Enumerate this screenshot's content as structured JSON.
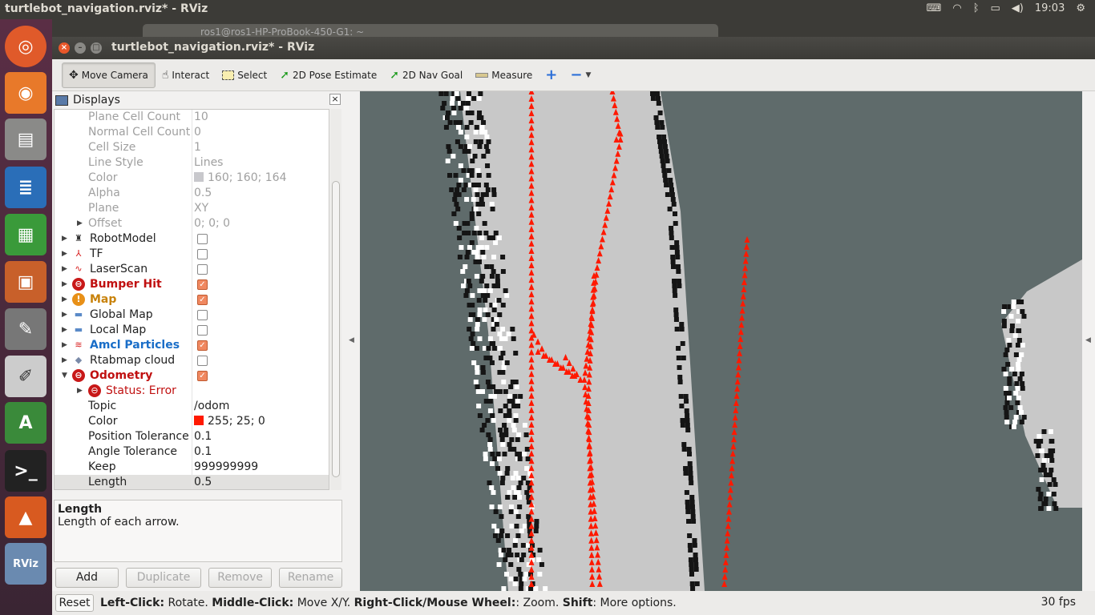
{
  "topbar": {
    "title": "turtlebot_navigation.rviz* - RViz",
    "clock": "19:03",
    "keyboard_icon": "keyboard-icon",
    "wifi_icon": "wifi-icon",
    "bluetooth_icon": "bluetooth-icon",
    "battery_icon": "battery-icon",
    "volume_icon": "volume-icon"
  },
  "background_window": {
    "title": "ros1@ros1-HP-ProBook-450-G1: ~"
  },
  "window": {
    "title": "turtlebot_navigation.rviz* - RViz"
  },
  "toolbar": {
    "move_camera": "Move Camera",
    "interact": "Interact",
    "select": "Select",
    "pose_estimate": "2D Pose Estimate",
    "nav_goal": "2D Nav Goal",
    "measure": "Measure",
    "plus": "+",
    "minus": "−"
  },
  "displays": {
    "title": "Displays",
    "rows": [
      {
        "name": "Plane Cell Count",
        "value": "10"
      },
      {
        "name": "Normal Cell Count",
        "value": "0"
      },
      {
        "name": "Cell Size",
        "value": "1"
      },
      {
        "name": "Line Style",
        "value": "Lines"
      },
      {
        "name": "Color",
        "value": "160; 160; 164"
      },
      {
        "name": "Alpha",
        "value": "0.5"
      },
      {
        "name": "Plane",
        "value": "XY"
      },
      {
        "name": "Offset",
        "value": "0; 0; 0"
      },
      {
        "name": "RobotModel",
        "checked": false
      },
      {
        "name": "TF",
        "checked": false
      },
      {
        "name": "LaserScan",
        "checked": false
      },
      {
        "name": "Bumper Hit",
        "checked": true
      },
      {
        "name": "Map",
        "checked": true
      },
      {
        "name": "Global Map",
        "checked": false
      },
      {
        "name": "Local Map",
        "checked": false
      },
      {
        "name": "Amcl Particles",
        "checked": true
      },
      {
        "name": "Rtabmap cloud",
        "checked": false
      },
      {
        "name": "Odometry",
        "checked": true
      },
      {
        "name": "Status: Error",
        "value": ""
      },
      {
        "name": "Topic",
        "value": "/odom"
      },
      {
        "name": "Color",
        "value": "255; 25; 0"
      },
      {
        "name": "Position Tolerance",
        "value": "0.1"
      },
      {
        "name": "Angle Tolerance",
        "value": "0.1"
      },
      {
        "name": "Keep",
        "value": "999999999"
      },
      {
        "name": "Length",
        "value": "0.5"
      }
    ]
  },
  "description": {
    "title": "Length",
    "text": "Length of each arrow."
  },
  "buttons": {
    "add": "Add",
    "duplicate": "Duplicate",
    "remove": "Remove",
    "rename": "Rename"
  },
  "status": {
    "reset": "Reset",
    "lc": "Left-Click:",
    "lc_t": " Rotate. ",
    "mc": "Middle-Click:",
    "mc_t": " Move X/Y. ",
    "rc": "Right-Click/Mouse Wheel:",
    "rc_t": ": Zoom. ",
    "sh": "Shift",
    "sh_t": ": More options.",
    "fps": "30 fps"
  },
  "colors": {
    "odom_arrow": "#ff1900",
    "map_free": "#c8c8c8",
    "map_unknown": "#5f6b6b",
    "error": "#c01010",
    "map_label": "#c8820a",
    "particles_label": "#1a6ec8"
  }
}
